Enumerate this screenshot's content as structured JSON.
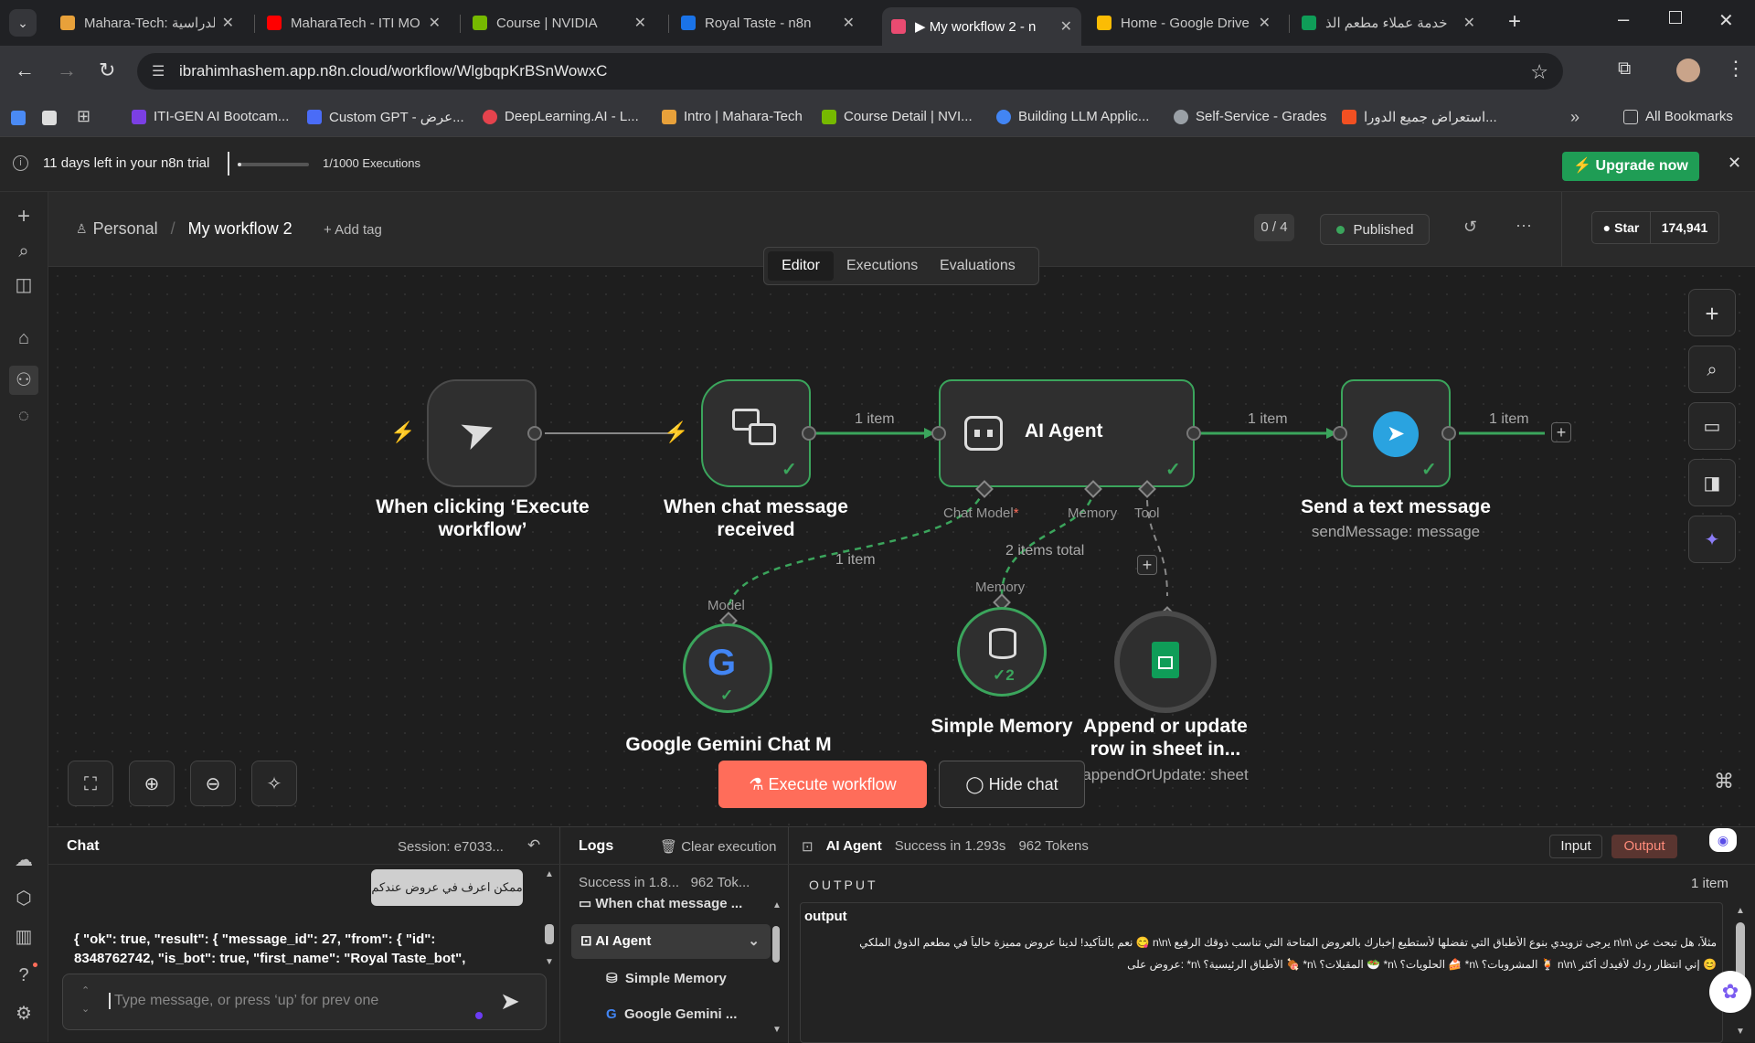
{
  "tabs": [
    {
      "title": "Mahara-Tech: الدراسية",
      "color": "#e8a13a"
    },
    {
      "title": "MaharaTech - ITI MO",
      "color": "#ff0000"
    },
    {
      "title": "Course | NVIDIA",
      "color": "#76b900"
    },
    {
      "title": "Royal Taste - n8n",
      "color": "#1a73e8"
    },
    {
      "title": "▶ My workflow 2 - n",
      "color": "#ea4b71"
    },
    {
      "title": "Home - Google Drive",
      "color": "#fbbc04"
    },
    {
      "title": "خدمة عملاء مطعم الذ",
      "color": "#0f9d58"
    }
  ],
  "browser": {
    "url": "ibrahimhashem.app.n8n.cloud/workflow/WlgbqpKrBSnWowxC",
    "all_bookmarks": "All Bookmarks"
  },
  "bookmarks": [
    {
      "label": "ITI-GEN AI Bootcam...",
      "color": "#7b3fe4"
    },
    {
      "label": "Custom GPT - عرض...",
      "color": "#4a6cf7"
    },
    {
      "label": "DeepLearning.AI - L...",
      "color": "#e5434d"
    },
    {
      "label": "Intro | Mahara-Tech",
      "color": "#e8a13a"
    },
    {
      "label": "Course Detail | NVI...",
      "color": "#76b900"
    },
    {
      "label": "Building LLM Applic...",
      "color": "#4285f4"
    },
    {
      "label": "Self-Service - Grades",
      "color": "#9aa0a6"
    },
    {
      "label": "استعراض جميع الدورا...",
      "color": "#f25022"
    }
  ],
  "trial": {
    "days_left": "11 days left in your n8n trial",
    "executions": "1/1000 Executions",
    "executions_progress": 0.001,
    "upgrade": "Upgrade now"
  },
  "header": {
    "project": "Personal",
    "workflow": "My workflow 2",
    "add_tag": "+ Add tag",
    "counter": "0 / 4",
    "status": "Published",
    "star": "Star",
    "star_count": "174,941"
  },
  "view_tabs": [
    "Editor",
    "Executions",
    "Evaluations"
  ],
  "nodes": {
    "manual": {
      "label": "When clicking ‘Execute workflow’"
    },
    "chat": {
      "label": "When chat message received"
    },
    "agent": {
      "label": "AI Agent",
      "port_chat": "Chat Model",
      "port_memory": "Memory",
      "port_tool": "Tool"
    },
    "telegram": {
      "label": "Send a text message",
      "sub": "sendMessage: message"
    },
    "gemini": {
      "label": "Google Gemini Chat M",
      "port": "Model"
    },
    "memory": {
      "label": "Simple Memory",
      "port": "Memory",
      "badge": "2"
    },
    "sheets": {
      "label": "Append or update row in sheet in...",
      "sub": "appendOrUpdate: sheet"
    }
  },
  "connections": {
    "chat_agent": "1 item",
    "agent_telegram": "1 item",
    "telegram_out": "1 item",
    "gemini": "1 item",
    "memory": "2 items total"
  },
  "actions": {
    "execute": "Execute workflow",
    "hide_chat": "Hide chat"
  },
  "chat": {
    "title": "Chat",
    "session": "Session: e7033...",
    "user_message": "ممكن اعرف في عروض عندكم",
    "bot_message": "{ \"ok\": true, \"result\": { \"message_id\": 27, \"from\": { \"id\": 8348762742, \"is_bot\": true, \"first_name\": \"Royal Taste_bot\",",
    "placeholder": "Type message, or press ‘up’ for prev one"
  },
  "logs": {
    "title": "Logs",
    "clear": "Clear execution",
    "summary": "Success in 1.8...",
    "tokens": "962 Tok...",
    "items": [
      "When chat message ...",
      "AI Agent",
      "Simple Memory",
      "Google Gemini ..."
    ]
  },
  "output": {
    "node": "AI Agent",
    "status": "Success in 1.293s",
    "tokens": "962 Tokens",
    "input_tab": "Input",
    "output_tab": "Output",
    "heading": "OUTPUT",
    "count": "1 item",
    "field": "output",
    "text1": "مثلاً، هل تبحث عن \\n\\n يرجى تزويدي بنوع الأطباق التي تفضلها لأستطيع إخبارك بالعروض المتاحة التي تناسب ذوقك الرفيع \\n\\n 😋 نعم بالتأكيد! لدينا عروض مميزة حالياً في مطعم الذوق الملكي",
    "text2": "😊 إني انتظار ردك لأفيدك أكثر \\n\\n 🍹 المشروبات؟ \\n* 🍰 الحلويات؟ \\n* 🥗 المقبلات؟ \\n* 🍖 الأطباق الرئيسية؟ \\n* :عروض على"
  },
  "colors": {
    "accent": "#ff6d5a",
    "success": "#3ba55c",
    "upgrade": "#1f9d55"
  }
}
